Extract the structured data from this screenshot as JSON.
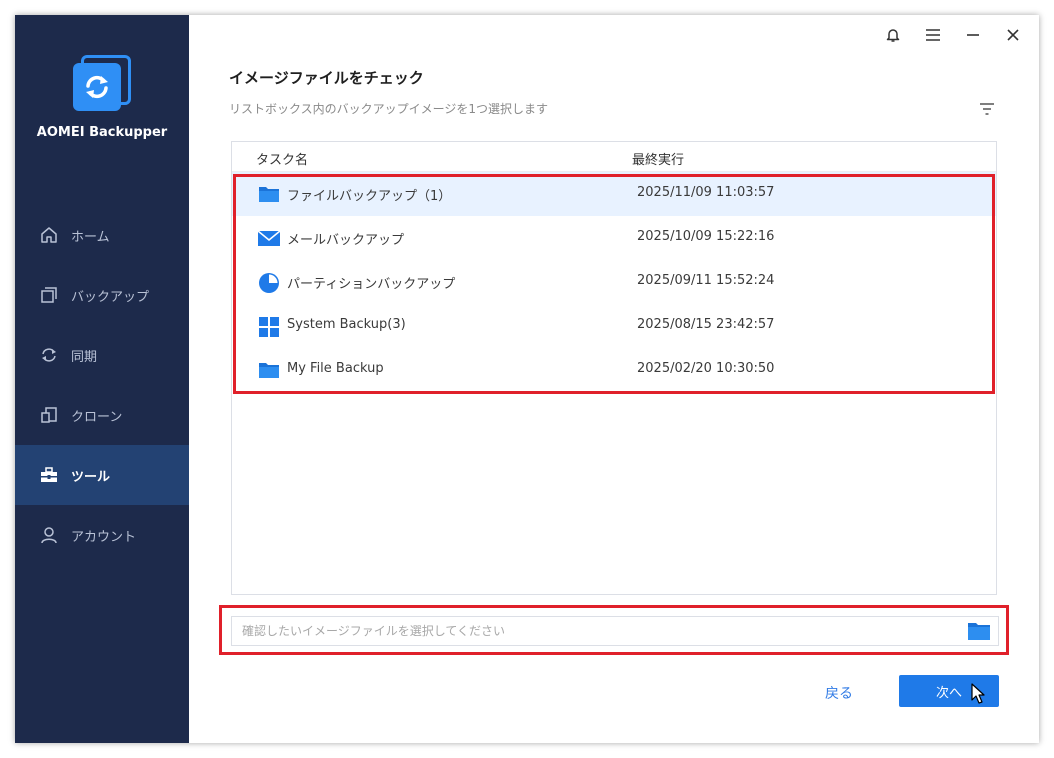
{
  "app": {
    "name": "AOMEI Backupper"
  },
  "sidebar": {
    "items": [
      {
        "label": "ホーム",
        "icon": "home-icon",
        "active": false
      },
      {
        "label": "バックアップ",
        "icon": "backup-icon",
        "active": false
      },
      {
        "label": "同期",
        "icon": "sync-icon",
        "active": false
      },
      {
        "label": "クローン",
        "icon": "clone-icon",
        "active": false
      },
      {
        "label": "ツール",
        "icon": "toolbox-icon",
        "active": true
      },
      {
        "label": "アカウント",
        "icon": "user-icon",
        "active": false
      }
    ]
  },
  "titlebar": {
    "buttons": [
      "bell-icon",
      "menu-icon",
      "minimize-icon",
      "close-icon"
    ]
  },
  "main": {
    "title": "イメージファイルをチェック",
    "subtitle": "リストボックス内のバックアップイメージを1つ選択します",
    "table": {
      "columns": [
        "タスク名",
        "最終実行"
      ],
      "rows": [
        {
          "name": "ファイルバックアップ（1）",
          "last_run": "2025/11/09 11:03:57",
          "icon": "folder-icon",
          "selected": true
        },
        {
          "name": "メールバックアップ",
          "last_run": "2025/10/09 15:22:16",
          "icon": "mail-icon",
          "selected": false
        },
        {
          "name": "パーティションバックアップ",
          "last_run": "2025/09/11 15:52:24",
          "icon": "partition-icon",
          "selected": false
        },
        {
          "name": "System Backup(3)",
          "last_run": "2025/08/15 23:42:57",
          "icon": "windows-icon",
          "selected": false
        },
        {
          "name": "My File Backup",
          "last_run": "2025/02/20 10:30:50",
          "icon": "folder-icon",
          "selected": false
        }
      ]
    },
    "path_input": {
      "placeholder": "確認したいイメージファイルを選択してください",
      "value": ""
    },
    "back_label": "戻る",
    "next_label": "次へ"
  },
  "colors": {
    "sidebar": "#1d2a4b",
    "sidebar_active": "#234273",
    "accent": "#1f7ae8",
    "highlight": "#e0202a",
    "selected_row": "#e8f2ff"
  }
}
